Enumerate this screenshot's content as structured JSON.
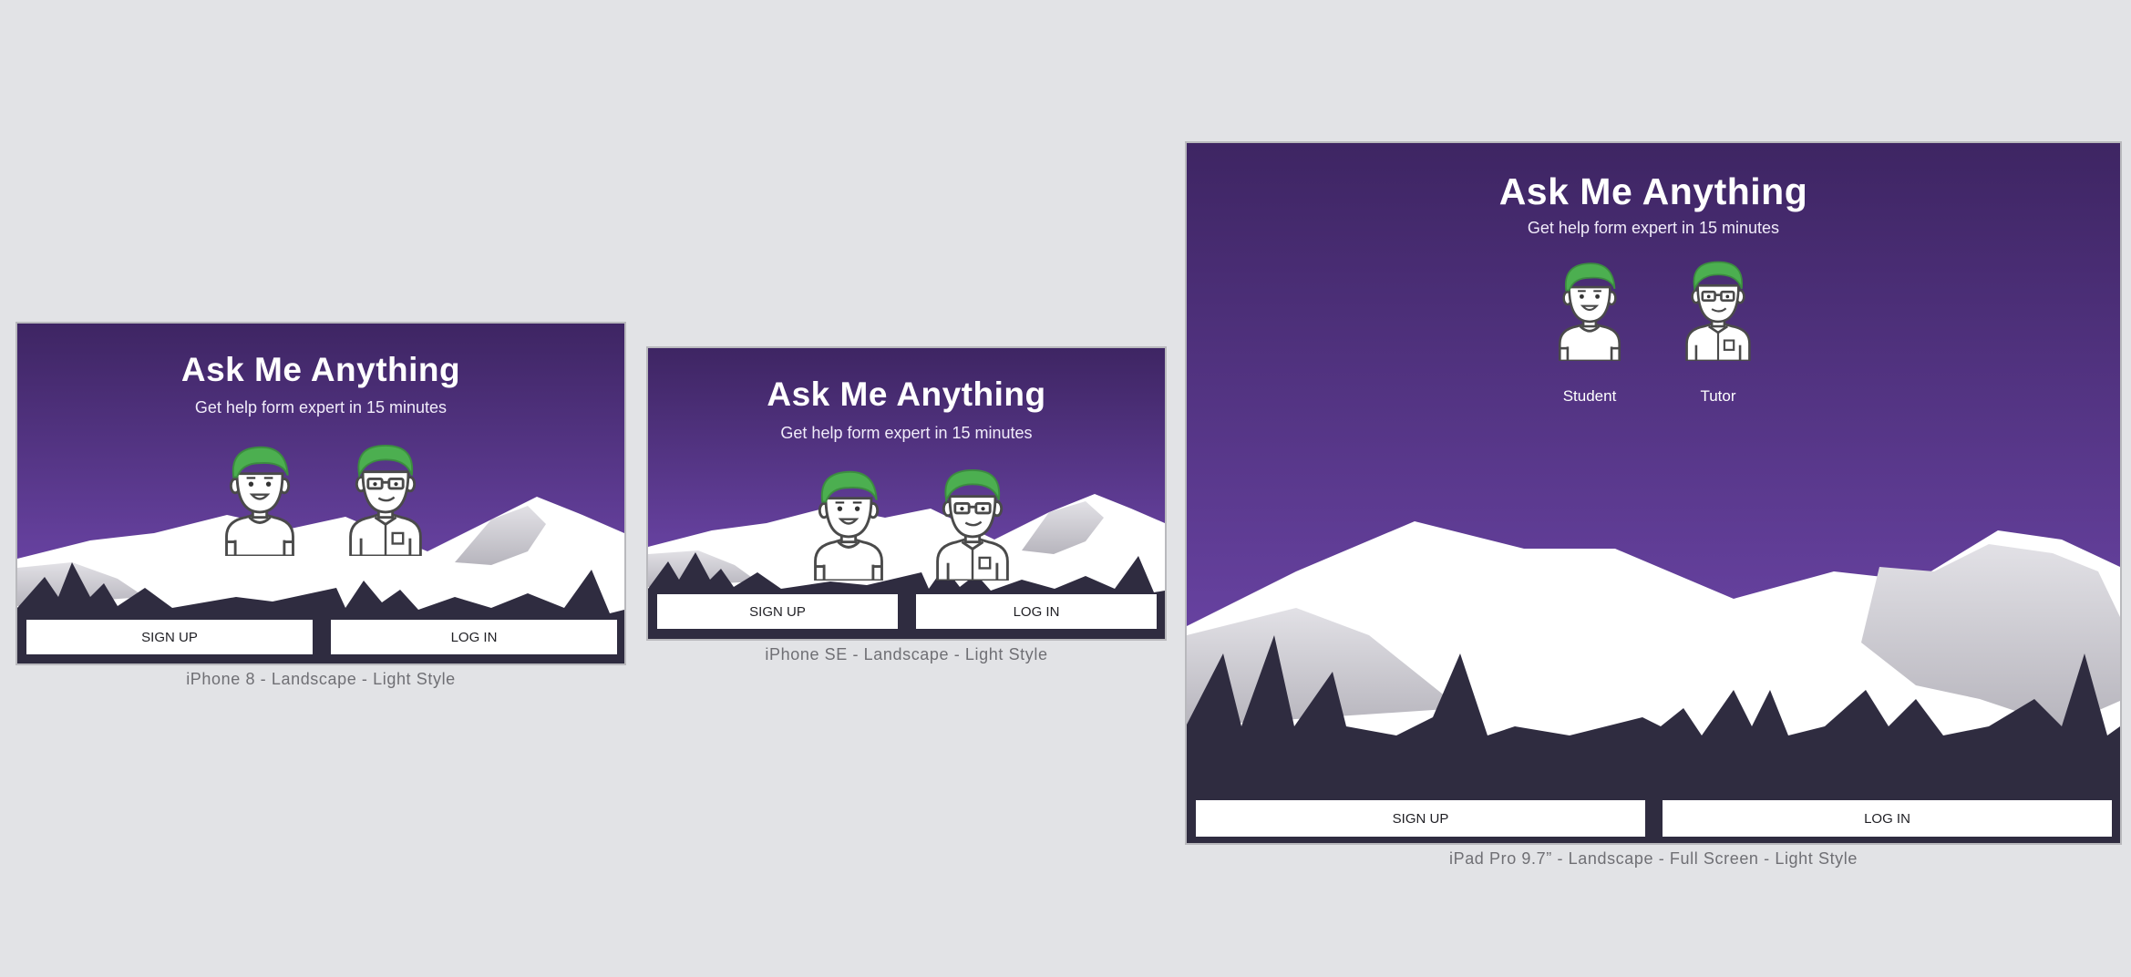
{
  "colors": {
    "canvas": "#e2e3e6",
    "sky_top": "#3e2563",
    "sky_bottom": "#6a44a5",
    "ground": "#2f2c40",
    "accent_hair": "#4caf50",
    "button_bg": "#ffffff"
  },
  "app": {
    "title": "Ask Me Anything",
    "subtitle": "Get help form expert in 15 minutes",
    "sign_up_label": "SIGN UP",
    "log_in_label": "LOG  IN",
    "student_label": "Student",
    "tutor_label": "Tutor"
  },
  "devices": {
    "iphone8": {
      "caption": "iPhone 8 - Landscape - Light Style"
    },
    "iphonese": {
      "caption": "iPhone SE - Landscape - Light Style"
    },
    "ipad": {
      "caption": "iPad Pro 9.7” - Landscape - Full Screen - Light Style"
    }
  },
  "icons": {
    "student": "student-avatar-icon",
    "tutor": "tutor-avatar-icon"
  }
}
